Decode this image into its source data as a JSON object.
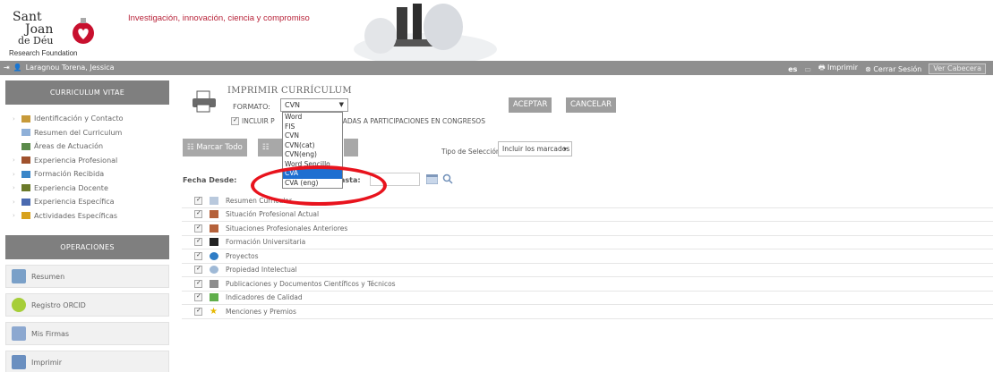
{
  "header": {
    "logo_line1": "Sant",
    "logo_line2": "Joan",
    "logo_line3": "de Déu",
    "logo_sub": "Research Foundation",
    "tagline": "Investigación, innovación, ciencia y compromiso"
  },
  "topbar": {
    "user_name": "Laragnou Torena, Jessica",
    "lang": "es",
    "print_label": "Imprimir",
    "logout_label": "Cerrar Sesión",
    "view_header_label": "Ver Cabecera"
  },
  "sidebar": {
    "cv_title": "CURRICULUM VITAE",
    "items": [
      {
        "label": "Identificación y Contacto",
        "icon": "id-card-icon"
      },
      {
        "label": "Resumen del Curriculum",
        "icon": "document-icon"
      },
      {
        "label": "Áreas de Actuación",
        "icon": "area-icon"
      },
      {
        "label": "Experiencia Profesional",
        "icon": "briefcase-icon"
      },
      {
        "label": "Formación Recibida",
        "icon": "graduation-icon"
      },
      {
        "label": "Experiencia Docente",
        "icon": "board-icon"
      },
      {
        "label": "Experiencia Específica",
        "icon": "people-icon"
      },
      {
        "label": "Actividades Específicas",
        "icon": "activity-icon"
      }
    ],
    "ops_title": "OPERACIONES",
    "ops": [
      {
        "label": "Resumen",
        "icon": "summary-icon"
      },
      {
        "label": "Registro ORCID",
        "icon": "orcid-icon"
      },
      {
        "label": "Mis Firmas",
        "icon": "signature-icon"
      },
      {
        "label": "Imprimir",
        "icon": "printer-icon"
      }
    ]
  },
  "main": {
    "title": "IMPRIMIR CURRÍCULUM",
    "format_label": "FORMATO:",
    "format_value": "CVN",
    "accept_label": "ACEPTAR",
    "cancel_label": "CANCELAR",
    "incluir_prefix": "INCLUIR P",
    "incluir_suffix": "CULADAS A PARTICIPACIONES EN CONGRESOS",
    "mark_all_label": "Marcar Todo",
    "tipo_label": "Tipo de Selección:",
    "tipo_value": "Incluir los marcados",
    "fecha_desde_label": "Fecha Desde:",
    "fecha_hasta_label": "asta:",
    "format_options": [
      "Word",
      "FIS",
      "CVN",
      "CVN(cat)",
      "CVN(eng)",
      "Word Sencillo",
      "CVA",
      "CVA (eng)"
    ],
    "selected_format_option": "CVA",
    "sections": [
      {
        "label": "Resumen Curricular",
        "icon": "document-icon"
      },
      {
        "label": "Situación Profesional Actual",
        "icon": "briefcase-icon"
      },
      {
        "label": "Situaciones Profesionales Anteriores",
        "icon": "briefcase-icon"
      },
      {
        "label": "Formación Universitaria",
        "icon": "graduation-cap-icon"
      },
      {
        "label": "Proyectos",
        "icon": "project-icon"
      },
      {
        "label": "Propiedad Intelectual",
        "icon": "gear-icon"
      },
      {
        "label": "Publicaciones y Documentos Científicos y Técnicos",
        "icon": "book-icon"
      },
      {
        "label": "Indicadores de Calidad",
        "icon": "chart-icon"
      },
      {
        "label": "Menciones y Premios",
        "icon": "star-icon"
      }
    ]
  },
  "colors": {
    "brand_red": "#b8243a",
    "bar_gray": "#8f8f8f",
    "highlight": "#e8131d",
    "selected_option": "#1e6fd1"
  }
}
